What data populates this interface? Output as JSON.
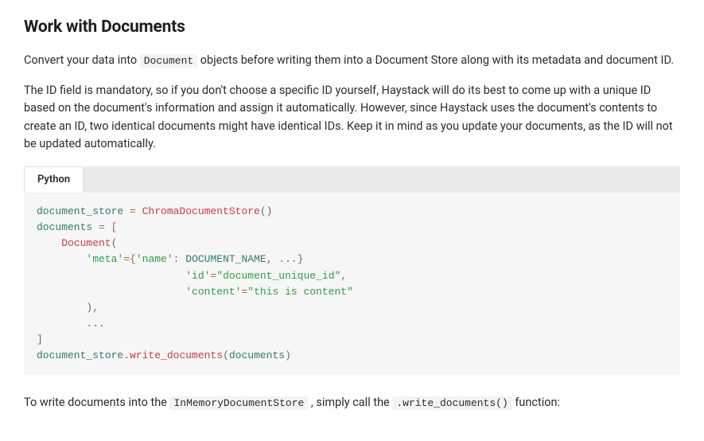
{
  "heading": "Work with Documents",
  "para1": {
    "before": "Convert your data into ",
    "code": "Document",
    "after": " objects before writing them into a Document Store along with its metadata and document ID."
  },
  "para2": "The ID field is mandatory, so if you don't choose a specific ID yourself, Haystack will do its best to come up with a unique ID based on the document's information and assign it automatically. However, since Haystack uses the document's contents to create an ID, two identical documents might have identical IDs. Keep it in mind as you update your documents, as the ID will not be updated automatically.",
  "codeblock": {
    "tab_label": "Python",
    "tokens": {
      "t1": "document_store",
      "t2": " = ",
      "t3": "ChromaDocumentStore",
      "t4": "()",
      "t5": "documents",
      "t6": " = [",
      "t7": "    ",
      "t8": "Document",
      "t9": "(",
      "t10": "        ",
      "t11": "'meta'",
      "t12": "={",
      "t13": "'name'",
      "t14": ": ",
      "t15": "DOCUMENT_NAME",
      "t16": ", ...}",
      "t17": "                        ",
      "t18": "'id'",
      "t19": "=",
      "t20": "\"document_unique_id\"",
      "t21": ",",
      "t22": "                        ",
      "t23": "'content'",
      "t24": "=",
      "t25": "\"this is content\"",
      "t26": "        ),",
      "t27": "        ...",
      "t28": "]",
      "t29": "document_store",
      "t30": ".",
      "t31": "write_documents",
      "t32": "(",
      "t33": "documents",
      "t34": ")"
    }
  },
  "para3": {
    "p1": "To write documents into the ",
    "c1": "InMemoryDocumentStore",
    "p2": " , simply call the ",
    "c2": ".write_documents()",
    "p3": " function:"
  }
}
